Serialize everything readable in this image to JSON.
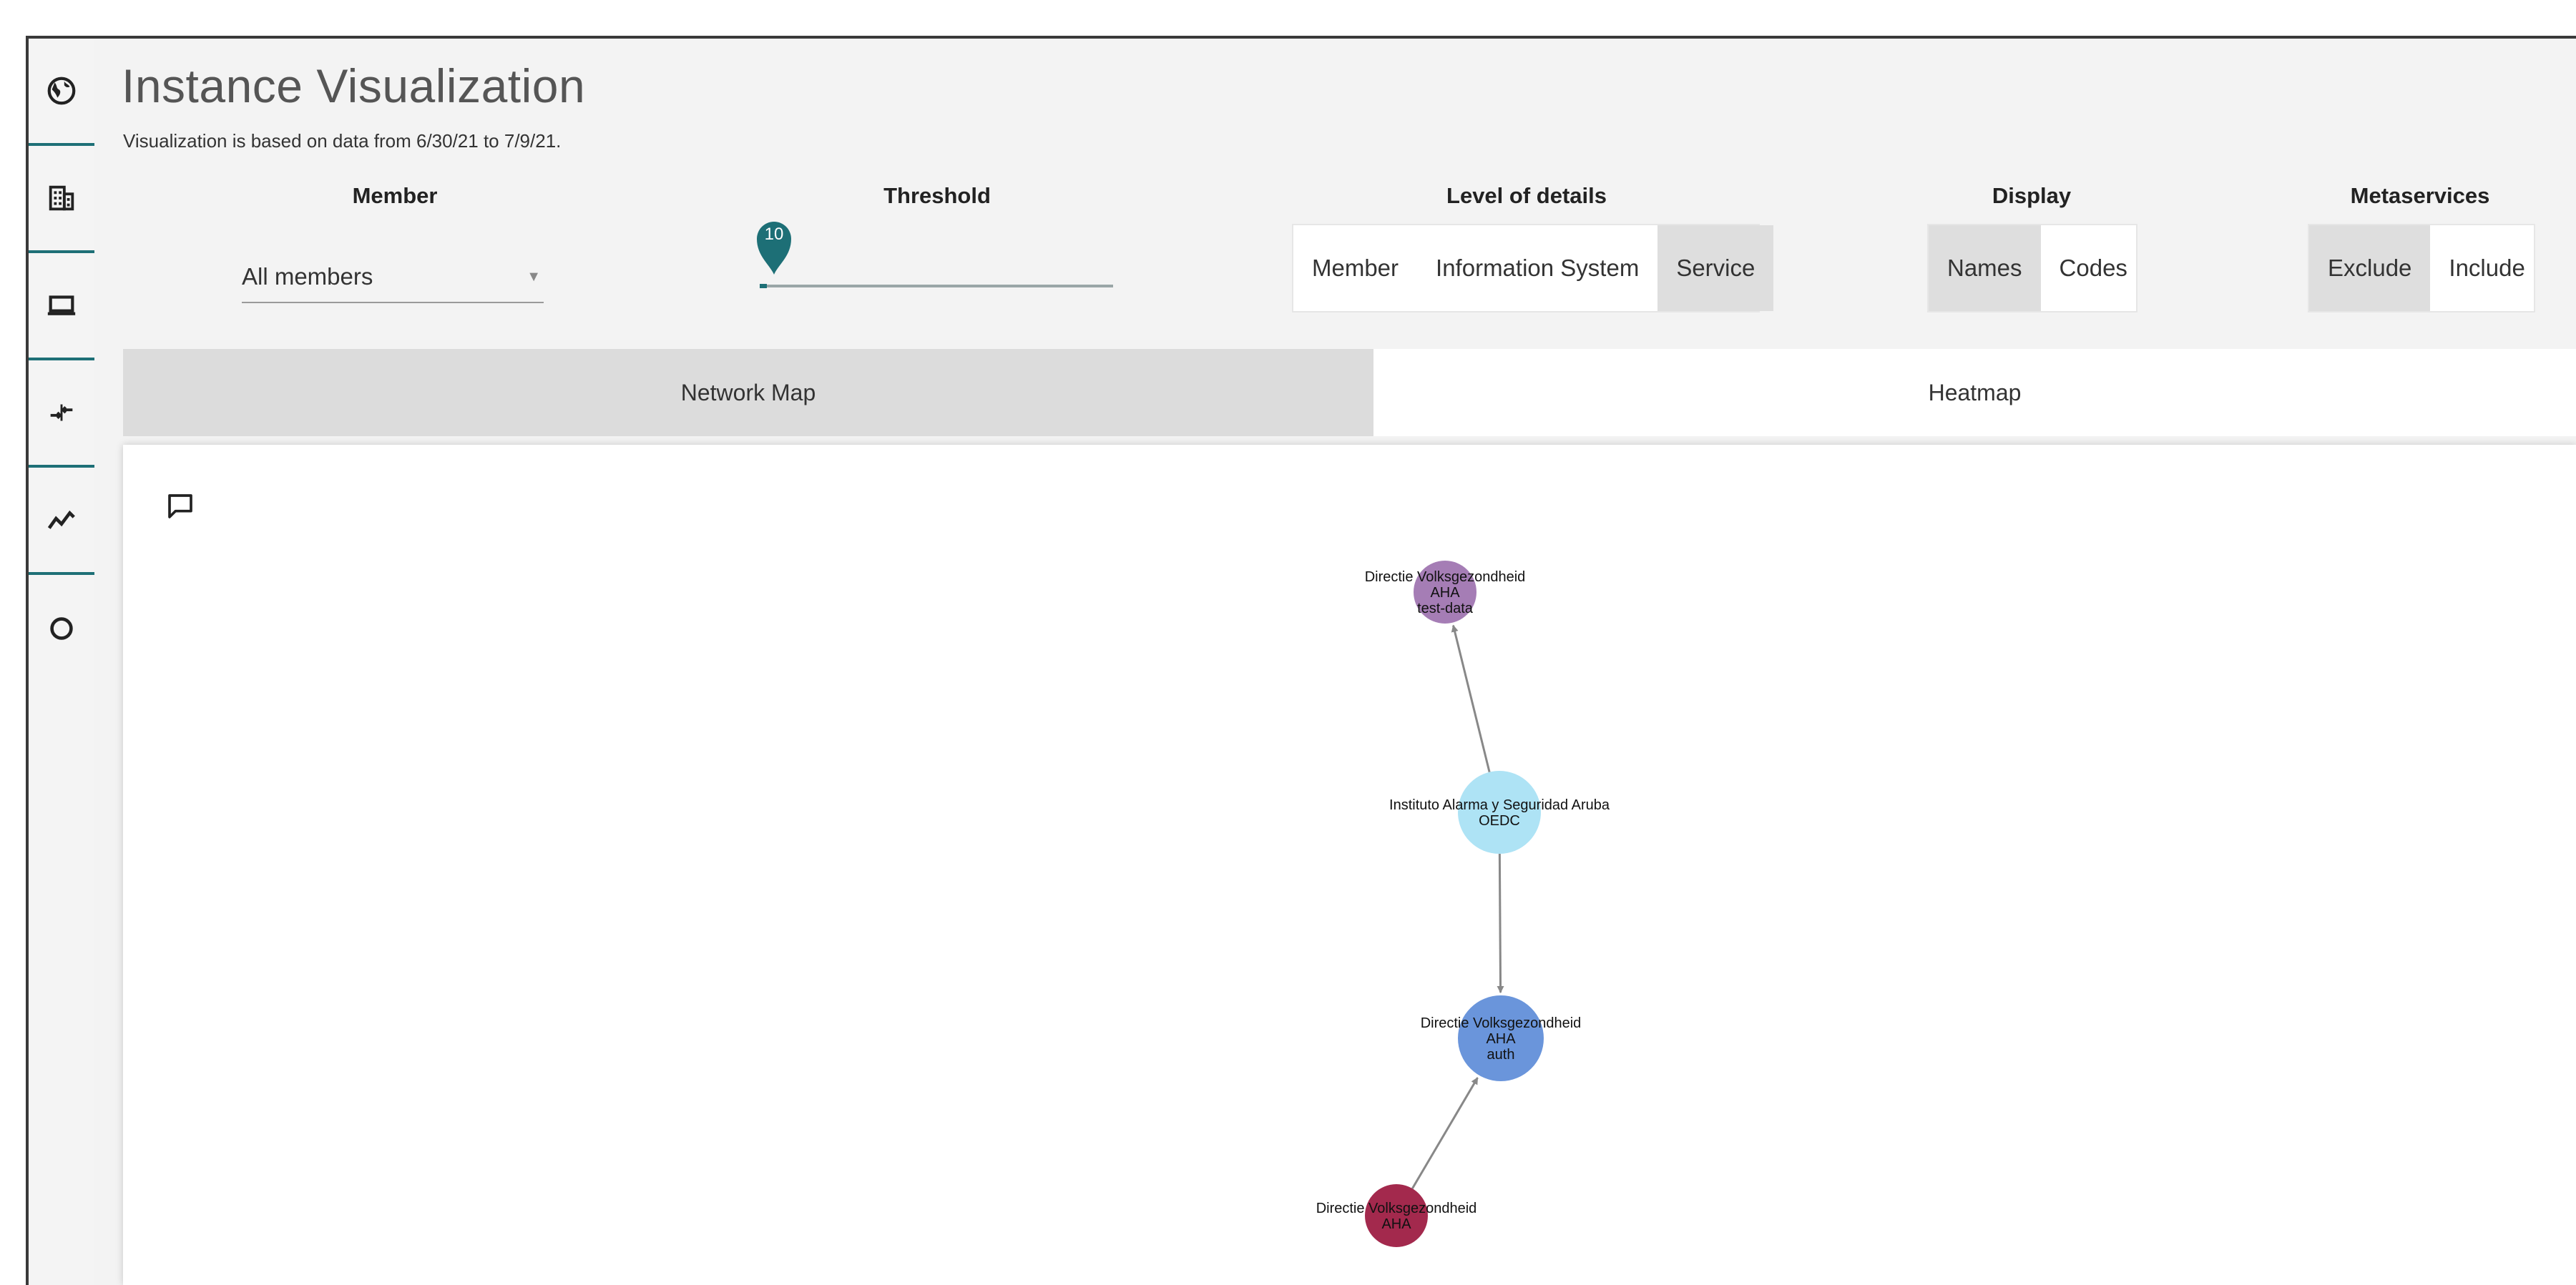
{
  "header": {
    "title": "Instance Visualization",
    "subtitle": "Visualization is based on data from 6/30/21 to 7/9/21."
  },
  "sidebar": {
    "items": [
      {
        "icon": "globe-icon"
      },
      {
        "icon": "building-icon"
      },
      {
        "icon": "laptop-icon"
      },
      {
        "icon": "exchange-icon"
      },
      {
        "icon": "trend-icon"
      },
      {
        "icon": "circle-icon"
      }
    ]
  },
  "controls": {
    "member": {
      "label": "Member",
      "value": "All members"
    },
    "threshold": {
      "label": "Threshold",
      "value": "10",
      "level": 0.02
    },
    "level_of_details": {
      "label": "Level of details",
      "options": [
        "Member",
        "Information System",
        "Service"
      ],
      "selected": "Service"
    },
    "display": {
      "label": "Display",
      "options": [
        "Names",
        "Codes"
      ],
      "selected": "Names"
    },
    "metaservices": {
      "label": "Metaservices",
      "options": [
        "Exclude",
        "Include"
      ],
      "selected": "Exclude"
    }
  },
  "tabs": [
    {
      "label": "Network Map",
      "active": true
    },
    {
      "label": "Heatmap",
      "active": false
    }
  ],
  "graph": {
    "nodes": [
      {
        "id": "n1",
        "lines": [
          "Directie Volksgezondheid",
          "AHA",
          "test-data"
        ],
        "color": "#a57db5"
      },
      {
        "id": "n2",
        "lines": [
          "Instituto Alarma y Seguridad Aruba",
          "OEDC"
        ],
        "color": "#aee3f5"
      },
      {
        "id": "n3",
        "lines": [
          "Directie Volksgezondheid",
          "AHA",
          "auth"
        ],
        "color": "#6a95db"
      },
      {
        "id": "n4",
        "lines": [
          "Directie Volksgezondheid",
          "AHA"
        ],
        "color": "#a3294d"
      }
    ],
    "edges": [
      {
        "from": "n2",
        "to": "n1"
      },
      {
        "from": "n2",
        "to": "n3"
      },
      {
        "from": "n4",
        "to": "n3"
      }
    ],
    "edge_color": "#888888"
  },
  "colors": {
    "accent": "#1d6f76"
  }
}
